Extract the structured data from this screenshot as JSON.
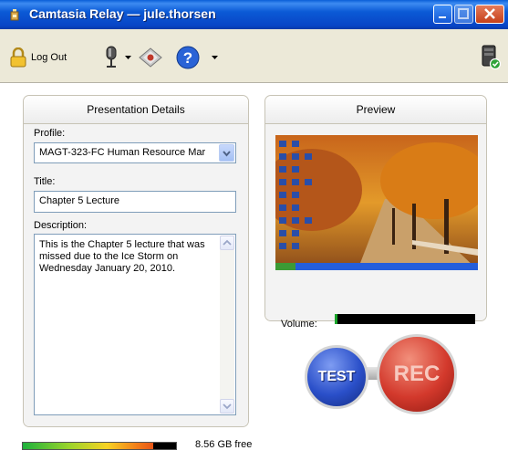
{
  "window": {
    "title": "Camtasia Relay — jule.thorsen"
  },
  "toolbar": {
    "logout_label": "Log Out",
    "icons": [
      "lock-icon",
      "microphone-icon",
      "dropdown-arrow-icon",
      "gem-icon",
      "help-icon",
      "dropdown-arrow-icon",
      "server-status-icon"
    ]
  },
  "details": {
    "heading": "Presentation Details",
    "profile_label": "Profile:",
    "profile_value": "MAGT-323-FC Human Resource Mar",
    "title_label": "Title:",
    "title_value": "Chapter 5 Lecture",
    "description_label": "Description:",
    "description_value": "This is the Chapter 5 lecture that was missed due to the Ice Storm on Wednesday January 20, 2010."
  },
  "preview": {
    "heading": "Preview",
    "volume_label": "Volume:",
    "volume_level": 0.02
  },
  "controls": {
    "test_label": "TEST",
    "rec_label": "REC"
  },
  "disk": {
    "free_text": "8.56 GB free",
    "used_fraction": 0.85
  },
  "colors": {
    "rec": "#d3392c",
    "test": "#2a4fc9",
    "titlebar": "#0a5fd8"
  }
}
